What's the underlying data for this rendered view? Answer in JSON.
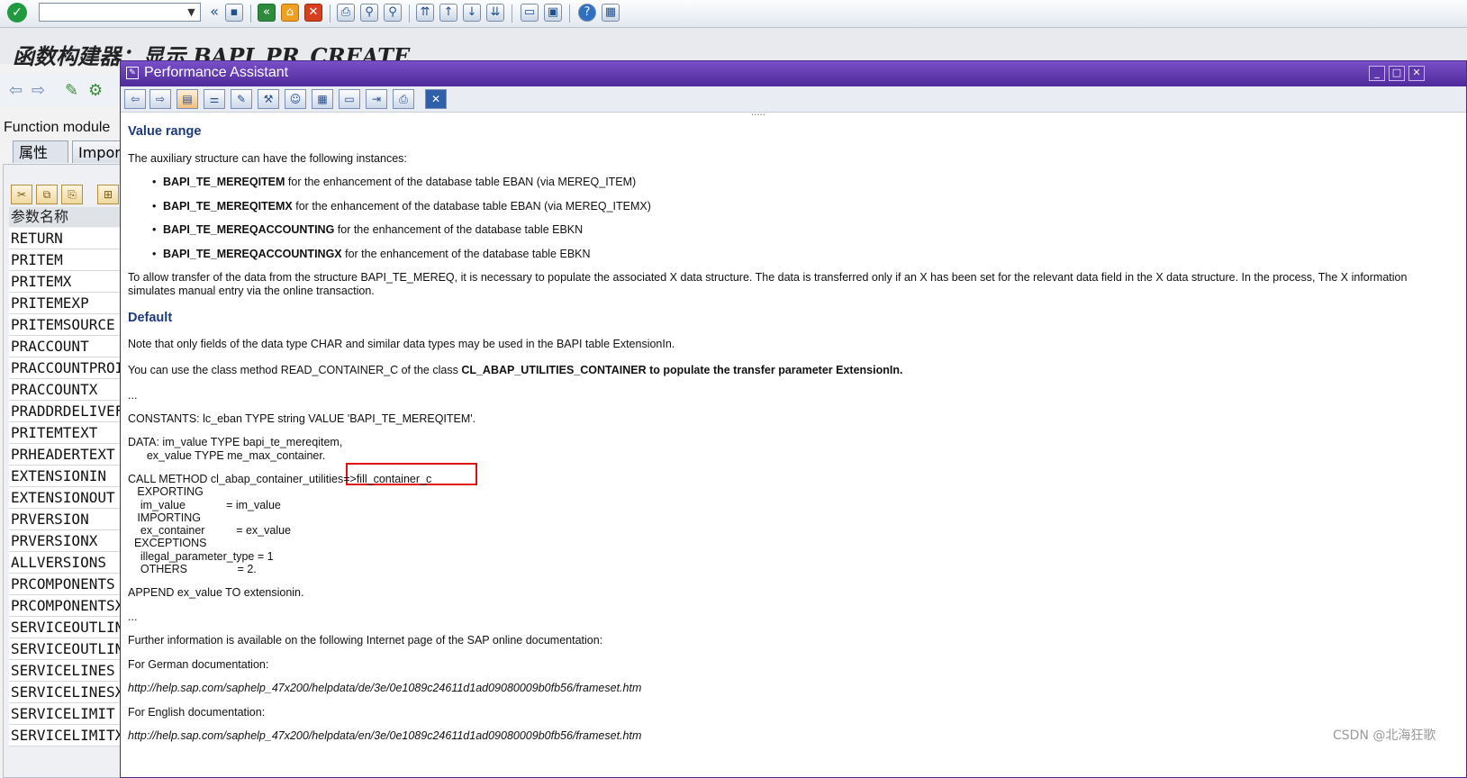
{
  "window": {
    "title": "函数构建器：显示 BAPI_PR_CREATE"
  },
  "toolbar": {
    "command_value": ""
  },
  "left": {
    "function_module_label": "Function module",
    "tabs": [
      "属性",
      "Import"
    ],
    "param_header": "参数名称",
    "params": [
      "RETURN",
      "PRITEM",
      "PRITEMX",
      "PRITEMEXP",
      "PRITEMSOURCE",
      "PRACCOUNT",
      "PRACCOUNTPROI",
      "PRACCOUNTX",
      "PRADDRDELIVEF",
      "PRITEMTEXT",
      "PRHEADERTEXT",
      "EXTENSIONIN",
      "EXTENSIONOUT",
      "PRVERSION",
      "PRVERSIONX",
      "ALLVERSIONS",
      "PRCOMPONENTS",
      "PRCOMPONENTSX",
      "SERVICEOUTLIN",
      "SERVICEOUTLIN",
      "SERVICELINES",
      "SERVICELINESX",
      "SERVICELIMIT",
      "SERVICELIMITX"
    ]
  },
  "popup": {
    "title": "Performance Assistant",
    "grip": "....."
  },
  "content": {
    "heading_value_range": "Value range",
    "intro": "The auxiliary structure can have the following instances:",
    "bullets": [
      {
        "name": "BAPI_TE_MEREQITEM",
        "text": " for the enhancement of the database table EBAN (via MEREQ_ITEM)"
      },
      {
        "name": "BAPI_TE_MEREQITEMX",
        "text": " for the enhancement of the database table EBAN (via MEREQ_ITEMX)"
      },
      {
        "name": "BAPI_TE_MEREQACCOUNTING",
        "text": " for the enhancement of the database table EBKN"
      },
      {
        "name": "BAPI_TE_MEREQACCOUNTINGX",
        "text": " for the enhancement of the database table EBKN"
      }
    ],
    "transfer_line1": "To allow transfer of the data from the structure BAPI_TE_MEREQ, it is necessary to populate the associated X data structure. The data is transferred only if an X has been set for the relevant data field in the X data structure. In the process, The X information",
    "transfer_line2": "simulates manual entry via the online transaction.",
    "heading_default": "Default",
    "note": "Note that only fields of the data type CHAR and similar data types may be used in the BAPI table ExtensionIn.",
    "class_pre": "You can use the class method READ_CONTAINER_C of the class ",
    "class_name": "CL_ABAP_UTILITIES_CONTAINER",
    "class_post": " to populate the transfer parameter ExtensionIn.",
    "ellipsis1": "...",
    "constants_pre": "CONSTANTS: lc_eban  TYPE string VALUE ",
    "constants_value": "'BAPI_TE_MEREQITEM'.",
    "data_line1": "DATA: im_value TYPE bapi_te_mereqitem,",
    "data_line2": "      ex_value TYPE me_max_container.",
    "code": [
      "CALL METHOD cl_abap_container_utilities=>fill_container_c",
      "   EXPORTING",
      "    im_value             = im_value",
      "   IMPORTING",
      "    ex_container          = ex_value",
      "  EXCEPTIONS",
      "    illegal_parameter_type = 1",
      "    OTHERS                = 2."
    ],
    "append": "APPEND ex_value TO extensionin.",
    "ellipsis2": "...",
    "further": "Further information is available on the following Internet page of the SAP online documentation:",
    "german_label": "For German documentation:",
    "german_url": "http://help.sap.com/saphelp_47x200/helpdata/de/3e/0e1089c24611d1ad09080009b0fb56/frameset.htm",
    "english_label": "For English documentation:",
    "english_url": "http://help.sap.com/saphelp_47x200/helpdata/en/3e/0e1089c24611d1ad09080009b0fb56/frameset.htm"
  },
  "watermark": "CSDN @北海狂歌"
}
